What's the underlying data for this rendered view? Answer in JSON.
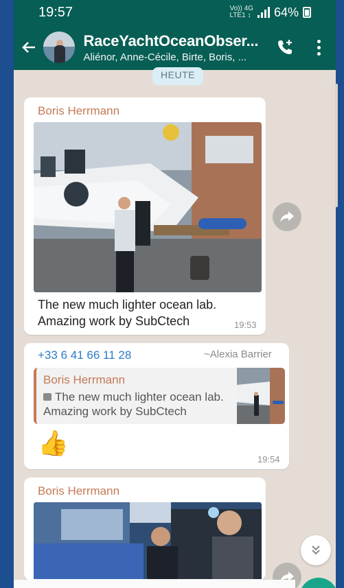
{
  "status_bar": {
    "time": "19:57",
    "network_small": "Vo)) 4G",
    "network_small2": "LTE1 ↕",
    "battery": "64%"
  },
  "app_bar": {
    "title": "RaceYachtOceanObser...",
    "subtitle": "Aliénor, Anne-Cécile, Birte, Boris, ..."
  },
  "date_chip": "HEUTE",
  "messages": [
    {
      "sender": "Boris Herrmann",
      "text": "The new much lighter ocean lab. Amazing work by SubCtech",
      "time": "19:53"
    },
    {
      "sender_phone": "+33 6 41 66 11 28",
      "sender_alias": "~Alexia Barrier",
      "quote_sender": "Boris Herrmann",
      "quote_text": "The new much lighter ocean lab. Amazing work by SubCtech",
      "emoji": "👍",
      "time": "19:54"
    },
    {
      "sender": "Boris Herrmann"
    }
  ],
  "colors": {
    "header": "#075e54",
    "chat_bg": "#e5ddd5",
    "sender_name": "#c37a56",
    "phone_link": "#2a7bc7"
  }
}
